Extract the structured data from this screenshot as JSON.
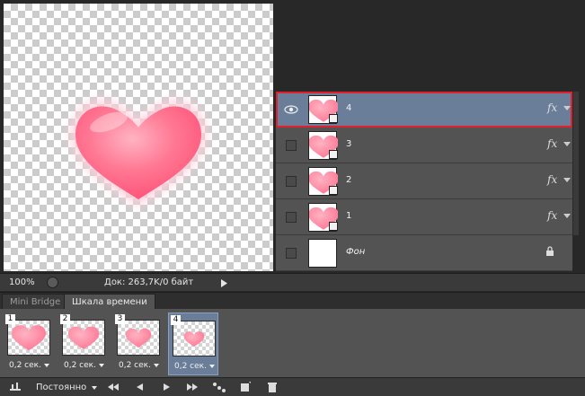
{
  "layers": [
    {
      "name": "4",
      "selected": true,
      "visible": true,
      "fx": "fx",
      "heart": "large"
    },
    {
      "name": "3",
      "selected": false,
      "visible": false,
      "fx": "fx",
      "heart": "large"
    },
    {
      "name": "2",
      "selected": false,
      "visible": false,
      "fx": "fx",
      "heart": "large"
    },
    {
      "name": "1",
      "selected": false,
      "visible": false,
      "fx": "fx",
      "heart": "large"
    },
    {
      "name": "Фон",
      "selected": false,
      "visible": false,
      "fx": "",
      "locked": true
    }
  ],
  "status": {
    "zoom": "100%",
    "doc": "Док: 263,7K/0 байт"
  },
  "tabs": [
    {
      "label": "Mini Bridge",
      "active": false
    },
    {
      "label": "Шкала времени",
      "active": true
    }
  ],
  "frames": [
    {
      "num": "1",
      "delay": "0,2 сек.",
      "heart_scale": 1.0,
      "selected": false
    },
    {
      "num": "2",
      "delay": "0,2 сек.",
      "heart_scale": 0.9,
      "selected": false
    },
    {
      "num": "3",
      "delay": "0,2 сек.",
      "heart_scale": 0.75,
      "selected": false
    },
    {
      "num": "4",
      "delay": "0,2 сек.",
      "heart_scale": 0.6,
      "selected": true
    }
  ],
  "toolbar": {
    "loop": "Постоянно"
  },
  "icons": {
    "eye": "eye-icon",
    "lock": "lock-icon",
    "zoom": "zoom-button-icon",
    "first": "first-frame-icon",
    "prev": "previous-frame-icon",
    "play": "play-icon",
    "next": "next-frame-icon",
    "tween": "tween-icon",
    "duplicate": "duplicate-frame-icon",
    "delete": "delete-frame-icon",
    "convert": "convert-timeline-icon"
  },
  "colors": {
    "heart": "#ff6e8c",
    "selection": "#e0202c",
    "selected_row": "#6a7e9a"
  }
}
